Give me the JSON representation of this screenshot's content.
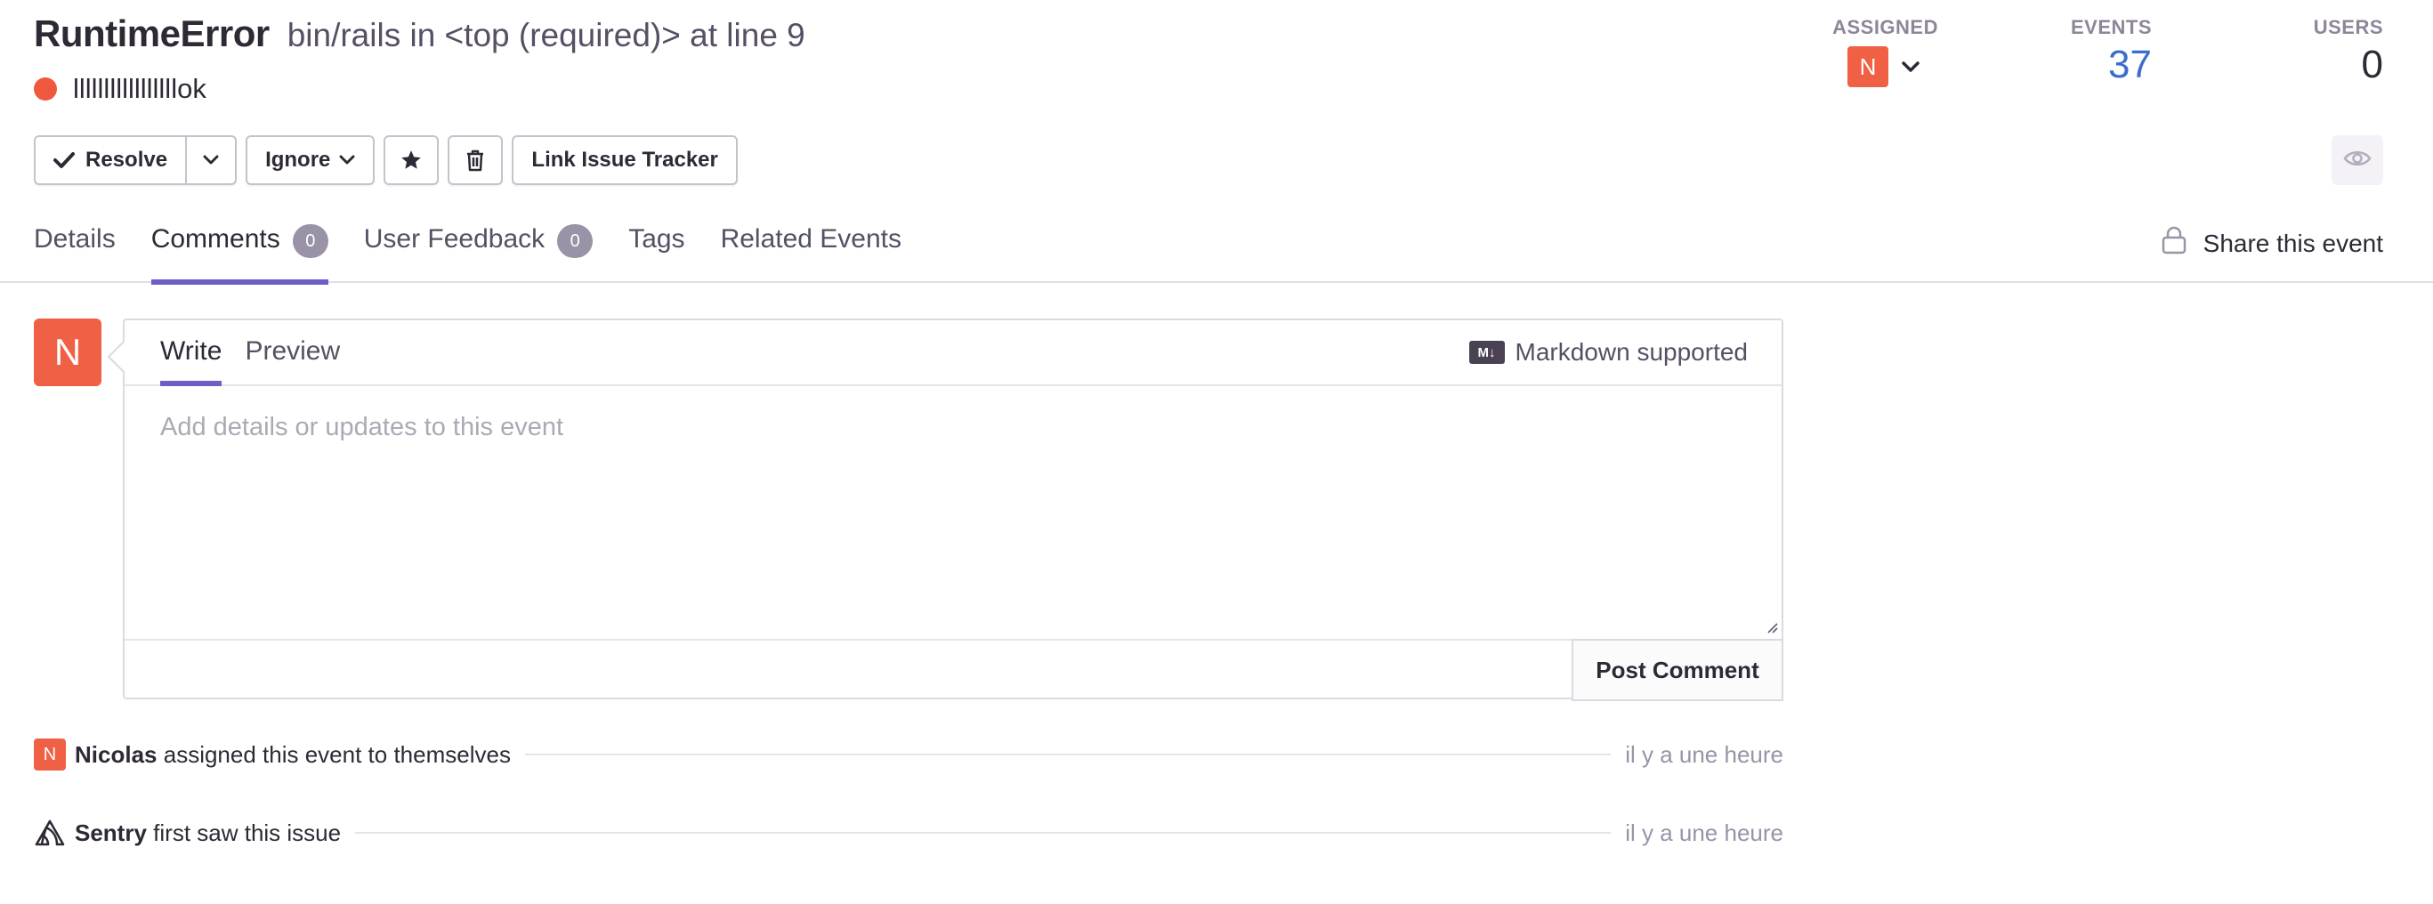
{
  "issue": {
    "type": "RuntimeError",
    "culprit": "bin/rails in <top (required)> at line 9",
    "message": "lllllllllllllllllok",
    "level_color": "#f0573f"
  },
  "stats": {
    "assigned_label": "ASSIGNED",
    "assignee_initial": "N",
    "events_label": "EVENTS",
    "events_value": "37",
    "users_label": "USERS",
    "users_value": "0"
  },
  "actions": {
    "resolve": "Resolve",
    "ignore": "Ignore",
    "link_tracker": "Link Issue Tracker"
  },
  "tabs": [
    {
      "label": "Details"
    },
    {
      "label": "Comments",
      "badge": "0"
    },
    {
      "label": "User Feedback",
      "badge": "0"
    },
    {
      "label": "Tags"
    },
    {
      "label": "Related Events"
    }
  ],
  "share_label": "Share this event",
  "comment": {
    "avatar_initial": "N",
    "write_tab": "Write",
    "preview_tab": "Preview",
    "markdown_icon": "M↓",
    "markdown_note": "Markdown supported",
    "placeholder": "Add details or updates to this event",
    "post_button": "Post Comment"
  },
  "activity": [
    {
      "avatar": "N",
      "actor": "Nicolas",
      "action": "assigned this event to themselves",
      "time": "il y a une heure"
    },
    {
      "actor": "Sentry",
      "action": "first saw this issue",
      "time": "il y a une heure"
    }
  ],
  "colors": {
    "accent": "#6c5fc7",
    "avatar": "#f06044",
    "link": "#3b6ecc"
  }
}
